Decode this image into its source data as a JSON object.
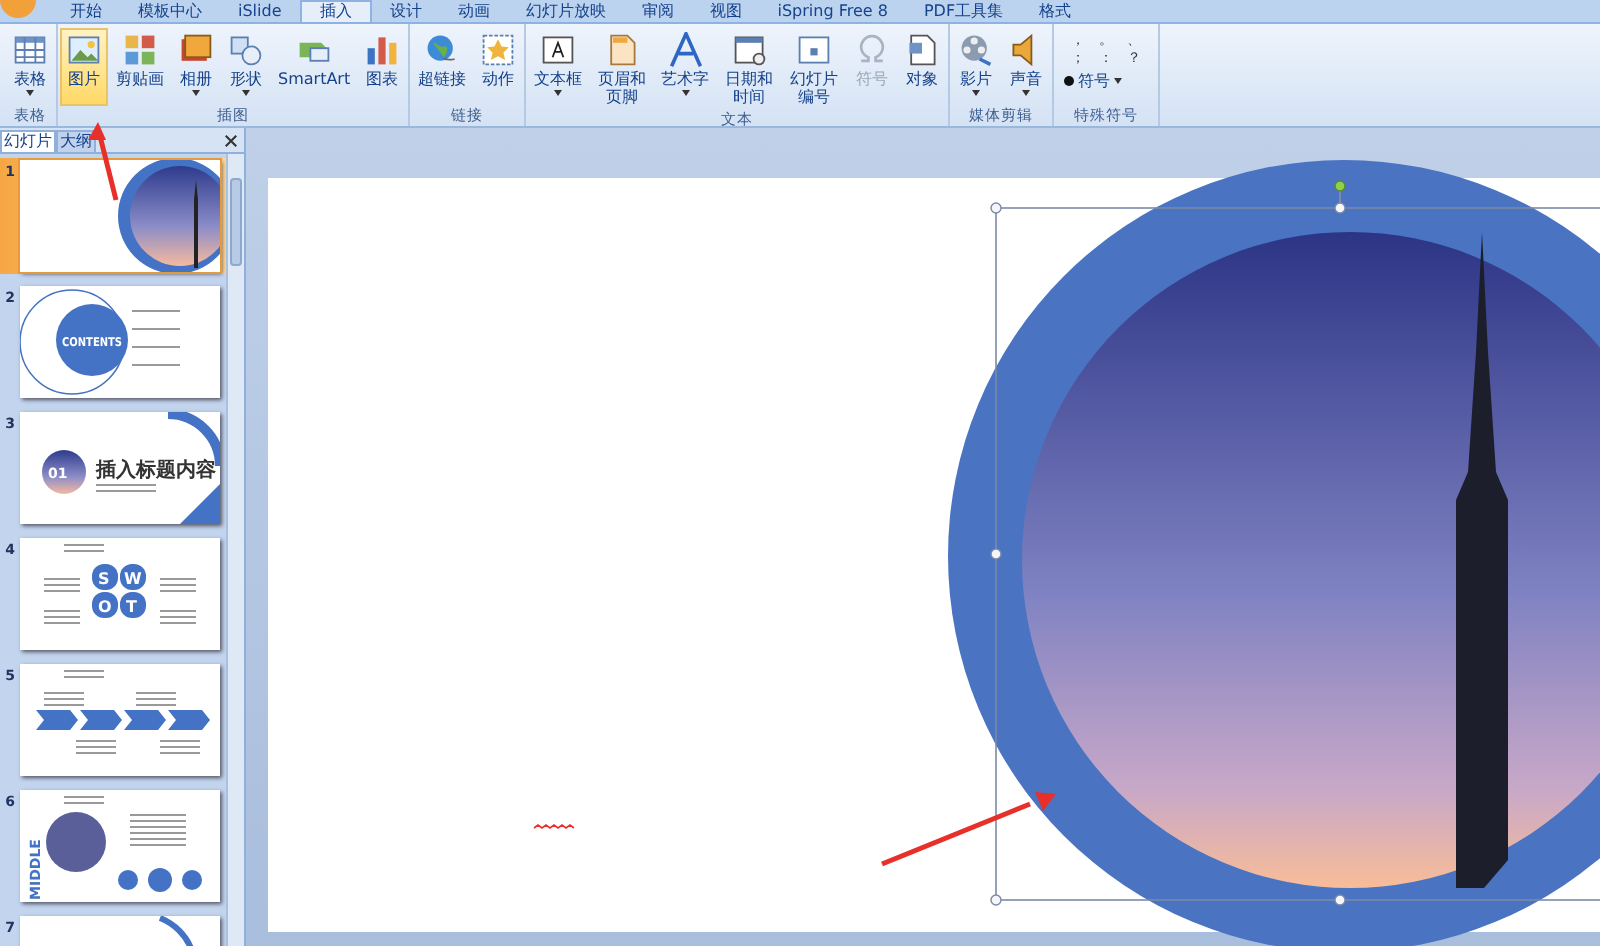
{
  "ribbon_tabs": [
    {
      "label": "开始",
      "selected": false
    },
    {
      "label": "模板中心",
      "selected": false
    },
    {
      "label": "iSlide",
      "selected": false
    },
    {
      "label": "插入",
      "selected": true
    },
    {
      "label": "设计",
      "selected": false
    },
    {
      "label": "动画",
      "selected": false
    },
    {
      "label": "幻灯片放映",
      "selected": false
    },
    {
      "label": "审阅",
      "selected": false
    },
    {
      "label": "视图",
      "selected": false
    },
    {
      "label": "iSpring Free 8",
      "selected": false
    },
    {
      "label": "PDF工具集",
      "selected": false
    },
    {
      "label": "格式",
      "selected": false
    }
  ],
  "ribbon_groups": [
    {
      "label": "表格",
      "kind": "buttons",
      "buttons": [
        {
          "label": "表格",
          "dropdown": true,
          "highlighted": false,
          "disabled": false
        }
      ]
    },
    {
      "label": "插图",
      "kind": "buttons",
      "buttons": [
        {
          "label": "图片",
          "dropdown": false,
          "highlighted": true,
          "disabled": false
        },
        {
          "label": "剪贴画",
          "dropdown": false,
          "highlighted": false,
          "disabled": false
        },
        {
          "label": "相册",
          "dropdown": true,
          "highlighted": false,
          "disabled": false
        },
        {
          "label": "形状",
          "dropdown": true,
          "highlighted": false,
          "disabled": false
        },
        {
          "label": "SmartArt",
          "dropdown": false,
          "highlighted": false,
          "disabled": false
        },
        {
          "label": "图表",
          "dropdown": false,
          "highlighted": false,
          "disabled": false
        }
      ]
    },
    {
      "label": "链接",
      "kind": "buttons",
      "buttons": [
        {
          "label": "超链接",
          "dropdown": false,
          "highlighted": false,
          "disabled": false
        },
        {
          "label": "动作",
          "dropdown": false,
          "highlighted": false,
          "disabled": false
        }
      ]
    },
    {
      "label": "文本",
      "kind": "buttons",
      "buttons": [
        {
          "label": "文本框",
          "dropdown": true,
          "highlighted": false,
          "disabled": false
        },
        {
          "label": "页眉和页脚",
          "dropdown": false,
          "highlighted": false,
          "disabled": false
        },
        {
          "label": "艺术字",
          "dropdown": true,
          "highlighted": false,
          "disabled": false
        },
        {
          "label": "日期和时间",
          "dropdown": false,
          "highlighted": false,
          "disabled": false
        },
        {
          "label": "幻灯片编号",
          "dropdown": false,
          "highlighted": false,
          "disabled": false
        },
        {
          "label": "符号",
          "dropdown": false,
          "highlighted": false,
          "disabled": true
        },
        {
          "label": "对象",
          "dropdown": false,
          "highlighted": false,
          "disabled": false
        }
      ]
    },
    {
      "label": "媒体剪辑",
      "kind": "buttons",
      "buttons": [
        {
          "label": "影片",
          "dropdown": true,
          "highlighted": false,
          "disabled": false
        },
        {
          "label": "声音",
          "dropdown": true,
          "highlighted": false,
          "disabled": false
        }
      ]
    },
    {
      "label": "特殊符号",
      "kind": "symbols",
      "symbols": [
        "，",
        "。",
        "、",
        "；",
        "：",
        "？"
      ],
      "button": {
        "label": "符号",
        "dropdown": true
      }
    }
  ],
  "panel_tabs": [
    {
      "label": "幻灯片",
      "selected": true
    },
    {
      "label": "大纲",
      "selected": false
    }
  ],
  "slides": [
    {
      "number": "1",
      "kind": "cover",
      "selected": true
    },
    {
      "number": "2",
      "kind": "contents",
      "selected": false,
      "heading": "CONTENTS"
    },
    {
      "number": "3",
      "kind": "title",
      "selected": false,
      "heading": "插入标题内容",
      "badge": "01"
    },
    {
      "number": "4",
      "kind": "swot",
      "selected": false,
      "letters": [
        "S",
        "W",
        "O",
        "T"
      ]
    },
    {
      "number": "5",
      "kind": "process",
      "selected": false
    },
    {
      "number": "6",
      "kind": "middle",
      "selected": false,
      "heading": "MIDDLE"
    },
    {
      "number": "7",
      "kind": "arc",
      "selected": false
    }
  ],
  "slide_canvas": {
    "picture": {
      "selected": true
    }
  }
}
